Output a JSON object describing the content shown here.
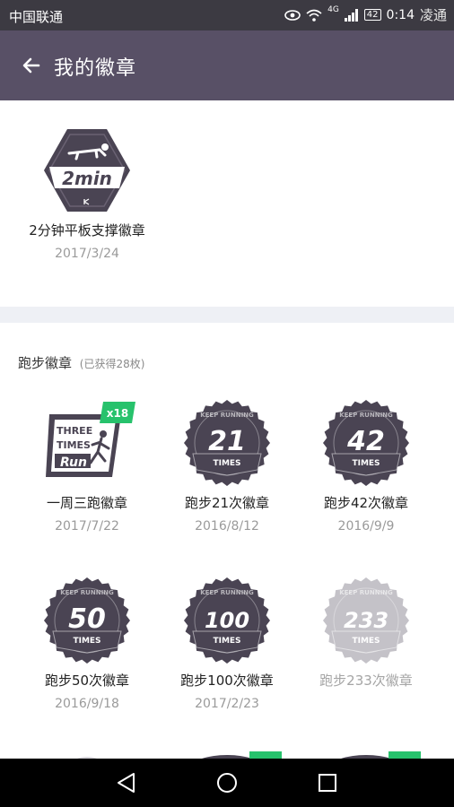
{
  "status_bar": {
    "carrier": "中国联通",
    "network": "4G",
    "battery": "42",
    "time": "0:14",
    "watermark": "凌通"
  },
  "app_bar": {
    "title": "我的徽章"
  },
  "featured": {
    "badge_text": "2min",
    "name": "2分钟平板支撑徽章",
    "date": "2017/3/24"
  },
  "section": {
    "title": "跑步徽章",
    "count_label": "(已获得28枚)",
    "badges": [
      {
        "name": "一周三跑徽章",
        "date": "2017/7/22",
        "badge_lines": [
          "THREE",
          "TIMES",
          "Run"
        ],
        "multiplier": "x18"
      },
      {
        "name": "跑步21次徽章",
        "date": "2016/8/12",
        "number": "21",
        "ring_text": "KEEP RUNNING",
        "sub": "TIMES"
      },
      {
        "name": "跑步42次徽章",
        "date": "2016/9/9",
        "number": "42",
        "ring_text": "KEEP RUNNING",
        "sub": "TIMES"
      },
      {
        "name": "跑步50次徽章",
        "date": "2016/9/18",
        "number": "50",
        "ring_text": "KEEP RUNNING",
        "sub": "TIMES"
      },
      {
        "name": "跑步100次徽章",
        "date": "2017/2/23",
        "number": "100",
        "ring_text": "KEEP RUNNING",
        "sub": "TIMES"
      },
      {
        "name": "跑步233次徽章",
        "date": "",
        "number": "233",
        "ring_text": "KEEP RUNNING",
        "sub": "TIMES",
        "locked": true
      }
    ]
  },
  "colors": {
    "app_bar": "#585066",
    "badge_dark": "#4a4453",
    "badge_locked": "#c4c2c8",
    "accent_green": "#27c26c"
  }
}
